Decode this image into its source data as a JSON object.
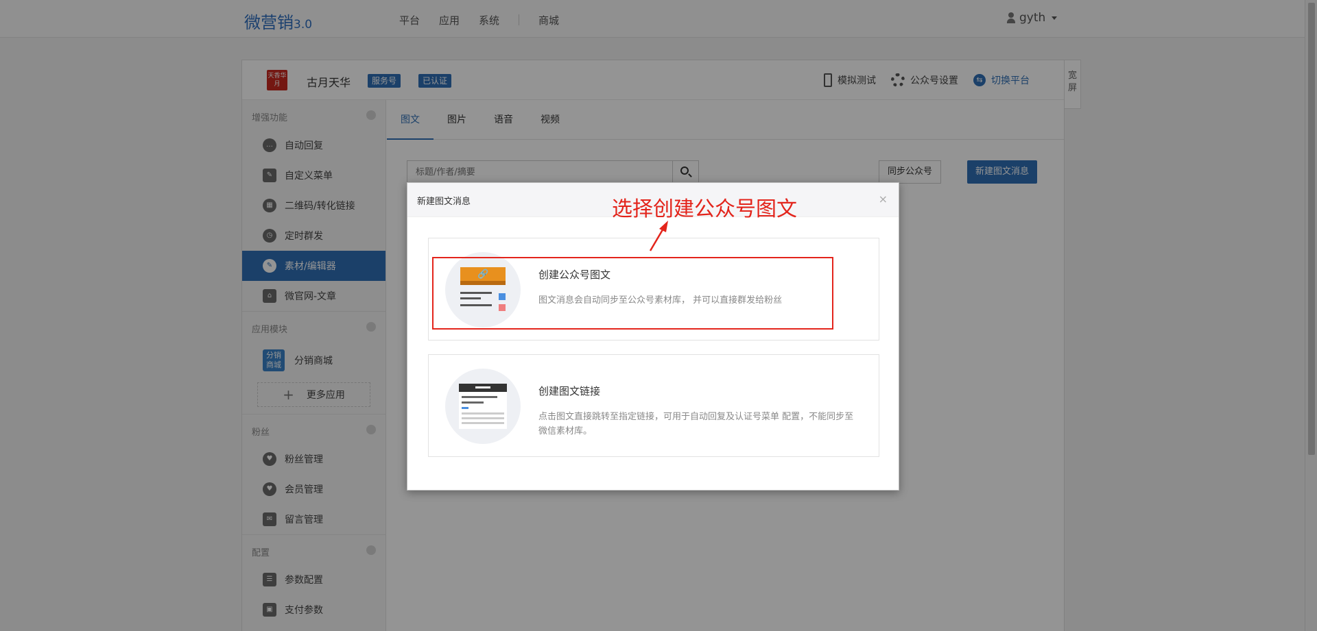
{
  "topbar": {
    "logo": "微营销",
    "logo_version": "3.0",
    "nav": [
      "平台",
      "应用",
      "系统",
      "商城"
    ],
    "user": "gyth"
  },
  "account": {
    "logo_text": "天香华月",
    "name": "古月天华",
    "badges": [
      "服务号",
      "已认证"
    ],
    "actions": {
      "simulate": "模拟测试",
      "settings": "公众号设置",
      "switch": "切换平台"
    }
  },
  "fullscreen": "宽屏",
  "sidebar": {
    "groups": [
      {
        "title": "增强功能",
        "items": [
          {
            "label": "自动回复",
            "icon": "chat-icon"
          },
          {
            "label": "自定义菜单",
            "icon": "edit-doc-icon"
          },
          {
            "label": "二维码/转化链接",
            "icon": "qrcode-icon"
          },
          {
            "label": "定时群发",
            "icon": "clock-icon"
          },
          {
            "label": "素材/编辑器",
            "icon": "pencil-icon",
            "active": true
          },
          {
            "label": "微官网-文章",
            "icon": "home-icon"
          }
        ]
      },
      {
        "title": "应用模块",
        "apps": [
          {
            "label": "分销商城",
            "icon_text": "分销商城"
          }
        ],
        "more": "更多应用"
      },
      {
        "title": "粉丝",
        "items": [
          {
            "label": "粉丝管理",
            "icon": "heart-icon"
          },
          {
            "label": "会员管理",
            "icon": "heart-icon"
          },
          {
            "label": "留言管理",
            "icon": "mail-icon"
          }
        ]
      },
      {
        "title": "配置",
        "items": [
          {
            "label": "参数配置",
            "icon": "list-icon"
          },
          {
            "label": "支付参数",
            "icon": "wallet-icon"
          }
        ]
      }
    ]
  },
  "main": {
    "tabs": [
      "图文",
      "图片",
      "语音",
      "视频"
    ],
    "active_tab": 0,
    "search_placeholder": "标题/作者/摘要",
    "sync_button": "同步公众号",
    "new_button": "新建图文消息"
  },
  "modal": {
    "title": "新建图文消息",
    "close": "×",
    "options": [
      {
        "title": "创建公众号图文",
        "desc": "图文消息会自动同步至公众号素材库， 并可以直接群发给粉丝"
      },
      {
        "title": "创建图文链接",
        "desc": "点击图文直接跳转至指定链接，可用于自动回复及认证号菜单 配置，不能同步至微信素材库。"
      }
    ]
  },
  "annotation": {
    "text": "选择创建公众号图文",
    "color": "#e3241b"
  },
  "colors": {
    "primary": "#2f6fb5",
    "accent_orange": "#e8901e"
  }
}
